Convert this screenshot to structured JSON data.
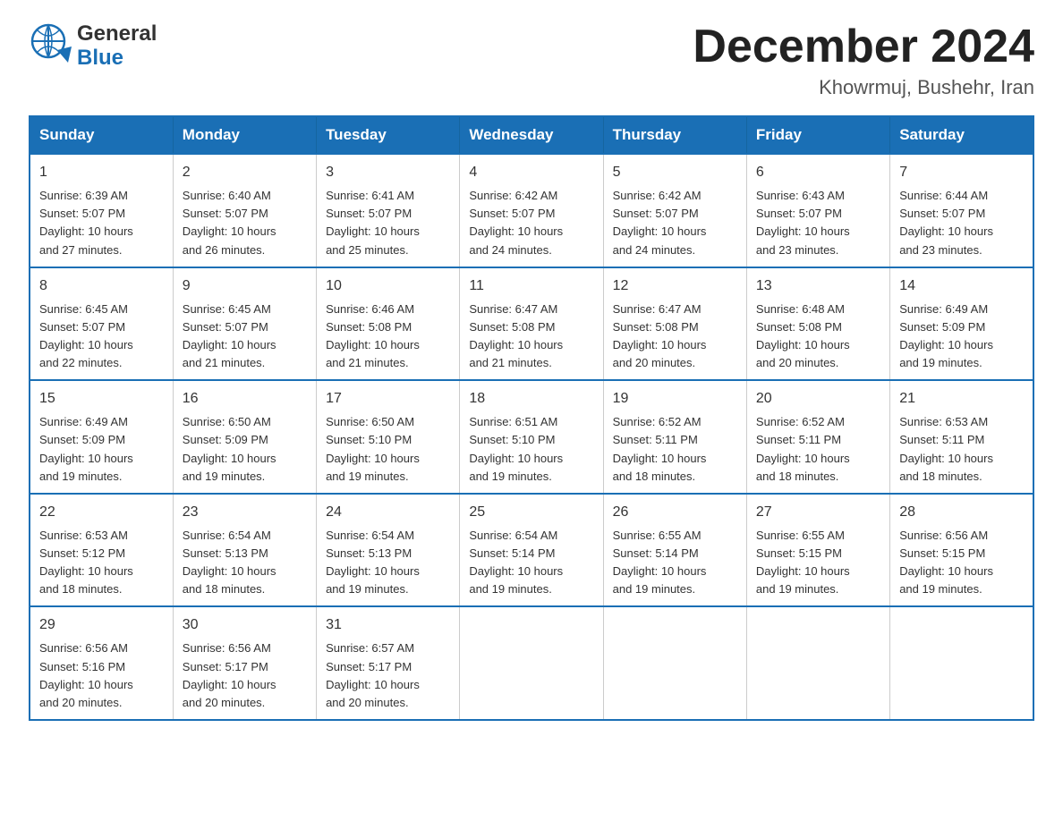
{
  "header": {
    "logo_top": "General",
    "logo_bottom": "Blue",
    "month_year": "December 2024",
    "location": "Khowrmuj, Bushehr, Iran"
  },
  "days_of_week": [
    "Sunday",
    "Monday",
    "Tuesday",
    "Wednesday",
    "Thursday",
    "Friday",
    "Saturday"
  ],
  "weeks": [
    [
      {
        "day": "1",
        "sunrise": "6:39 AM",
        "sunset": "5:07 PM",
        "daylight": "10 hours and 27 minutes."
      },
      {
        "day": "2",
        "sunrise": "6:40 AM",
        "sunset": "5:07 PM",
        "daylight": "10 hours and 26 minutes."
      },
      {
        "day": "3",
        "sunrise": "6:41 AM",
        "sunset": "5:07 PM",
        "daylight": "10 hours and 25 minutes."
      },
      {
        "day": "4",
        "sunrise": "6:42 AM",
        "sunset": "5:07 PM",
        "daylight": "10 hours and 24 minutes."
      },
      {
        "day": "5",
        "sunrise": "6:42 AM",
        "sunset": "5:07 PM",
        "daylight": "10 hours and 24 minutes."
      },
      {
        "day": "6",
        "sunrise": "6:43 AM",
        "sunset": "5:07 PM",
        "daylight": "10 hours and 23 minutes."
      },
      {
        "day": "7",
        "sunrise": "6:44 AM",
        "sunset": "5:07 PM",
        "daylight": "10 hours and 23 minutes."
      }
    ],
    [
      {
        "day": "8",
        "sunrise": "6:45 AM",
        "sunset": "5:07 PM",
        "daylight": "10 hours and 22 minutes."
      },
      {
        "day": "9",
        "sunrise": "6:45 AM",
        "sunset": "5:07 PM",
        "daylight": "10 hours and 21 minutes."
      },
      {
        "day": "10",
        "sunrise": "6:46 AM",
        "sunset": "5:08 PM",
        "daylight": "10 hours and 21 minutes."
      },
      {
        "day": "11",
        "sunrise": "6:47 AM",
        "sunset": "5:08 PM",
        "daylight": "10 hours and 21 minutes."
      },
      {
        "day": "12",
        "sunrise": "6:47 AM",
        "sunset": "5:08 PM",
        "daylight": "10 hours and 20 minutes."
      },
      {
        "day": "13",
        "sunrise": "6:48 AM",
        "sunset": "5:08 PM",
        "daylight": "10 hours and 20 minutes."
      },
      {
        "day": "14",
        "sunrise": "6:49 AM",
        "sunset": "5:09 PM",
        "daylight": "10 hours and 19 minutes."
      }
    ],
    [
      {
        "day": "15",
        "sunrise": "6:49 AM",
        "sunset": "5:09 PM",
        "daylight": "10 hours and 19 minutes."
      },
      {
        "day": "16",
        "sunrise": "6:50 AM",
        "sunset": "5:09 PM",
        "daylight": "10 hours and 19 minutes."
      },
      {
        "day": "17",
        "sunrise": "6:50 AM",
        "sunset": "5:10 PM",
        "daylight": "10 hours and 19 minutes."
      },
      {
        "day": "18",
        "sunrise": "6:51 AM",
        "sunset": "5:10 PM",
        "daylight": "10 hours and 19 minutes."
      },
      {
        "day": "19",
        "sunrise": "6:52 AM",
        "sunset": "5:11 PM",
        "daylight": "10 hours and 18 minutes."
      },
      {
        "day": "20",
        "sunrise": "6:52 AM",
        "sunset": "5:11 PM",
        "daylight": "10 hours and 18 minutes."
      },
      {
        "day": "21",
        "sunrise": "6:53 AM",
        "sunset": "5:11 PM",
        "daylight": "10 hours and 18 minutes."
      }
    ],
    [
      {
        "day": "22",
        "sunrise": "6:53 AM",
        "sunset": "5:12 PM",
        "daylight": "10 hours and 18 minutes."
      },
      {
        "day": "23",
        "sunrise": "6:54 AM",
        "sunset": "5:13 PM",
        "daylight": "10 hours and 18 minutes."
      },
      {
        "day": "24",
        "sunrise": "6:54 AM",
        "sunset": "5:13 PM",
        "daylight": "10 hours and 19 minutes."
      },
      {
        "day": "25",
        "sunrise": "6:54 AM",
        "sunset": "5:14 PM",
        "daylight": "10 hours and 19 minutes."
      },
      {
        "day": "26",
        "sunrise": "6:55 AM",
        "sunset": "5:14 PM",
        "daylight": "10 hours and 19 minutes."
      },
      {
        "day": "27",
        "sunrise": "6:55 AM",
        "sunset": "5:15 PM",
        "daylight": "10 hours and 19 minutes."
      },
      {
        "day": "28",
        "sunrise": "6:56 AM",
        "sunset": "5:15 PM",
        "daylight": "10 hours and 19 minutes."
      }
    ],
    [
      {
        "day": "29",
        "sunrise": "6:56 AM",
        "sunset": "5:16 PM",
        "daylight": "10 hours and 20 minutes."
      },
      {
        "day": "30",
        "sunrise": "6:56 AM",
        "sunset": "5:17 PM",
        "daylight": "10 hours and 20 minutes."
      },
      {
        "day": "31",
        "sunrise": "6:57 AM",
        "sunset": "5:17 PM",
        "daylight": "10 hours and 20 minutes."
      },
      null,
      null,
      null,
      null
    ]
  ],
  "labels": {
    "sunrise": "Sunrise:",
    "sunset": "Sunset:",
    "daylight": "Daylight:"
  }
}
